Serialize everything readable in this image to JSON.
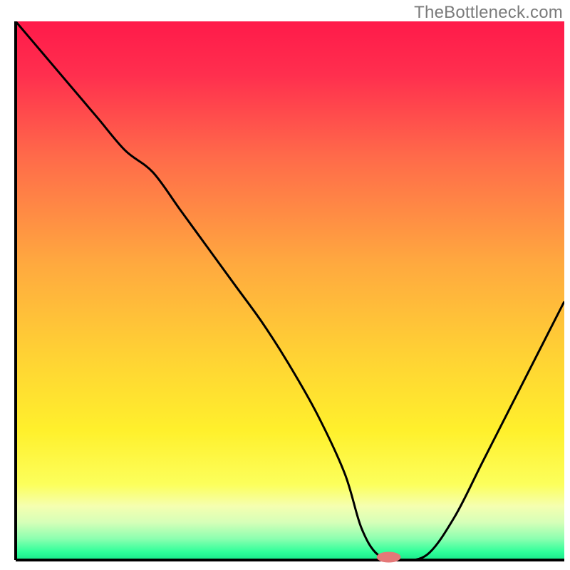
{
  "attribution": "TheBottleneck.com",
  "colors": {
    "axis": "#000000",
    "curve": "#000000",
    "marker_fill": "#e47878",
    "gradient_stops": [
      {
        "offset": 0.0,
        "color": "#ff1a4a"
      },
      {
        "offset": 0.1,
        "color": "#ff2f4e"
      },
      {
        "offset": 0.25,
        "color": "#ff6a4a"
      },
      {
        "offset": 0.45,
        "color": "#ffa93f"
      },
      {
        "offset": 0.62,
        "color": "#ffd234"
      },
      {
        "offset": 0.76,
        "color": "#fff02c"
      },
      {
        "offset": 0.86,
        "color": "#fcff5c"
      },
      {
        "offset": 0.9,
        "color": "#f5ffb0"
      },
      {
        "offset": 0.93,
        "color": "#d6ffb8"
      },
      {
        "offset": 0.96,
        "color": "#8dffb0"
      },
      {
        "offset": 0.985,
        "color": "#2fff9a"
      },
      {
        "offset": 1.0,
        "color": "#18e88a"
      }
    ]
  },
  "chart_data": {
    "type": "line",
    "title": "",
    "xlabel": "",
    "ylabel": "",
    "xlim": [
      0,
      100
    ],
    "ylim": [
      0,
      100
    ],
    "x": [
      0,
      5,
      10,
      15,
      20,
      25,
      30,
      35,
      40,
      45,
      50,
      55,
      60,
      63,
      66,
      70,
      75,
      80,
      85,
      90,
      95,
      100
    ],
    "values": [
      100,
      94,
      88,
      82,
      76,
      72,
      65,
      58,
      51,
      44,
      36,
      27,
      16,
      6,
      1,
      0,
      1,
      8,
      18,
      28,
      38,
      48
    ],
    "marker": {
      "x": 68,
      "y": 0,
      "rx": 2.2,
      "ry": 1.0
    },
    "legend": false,
    "grid": false
  }
}
